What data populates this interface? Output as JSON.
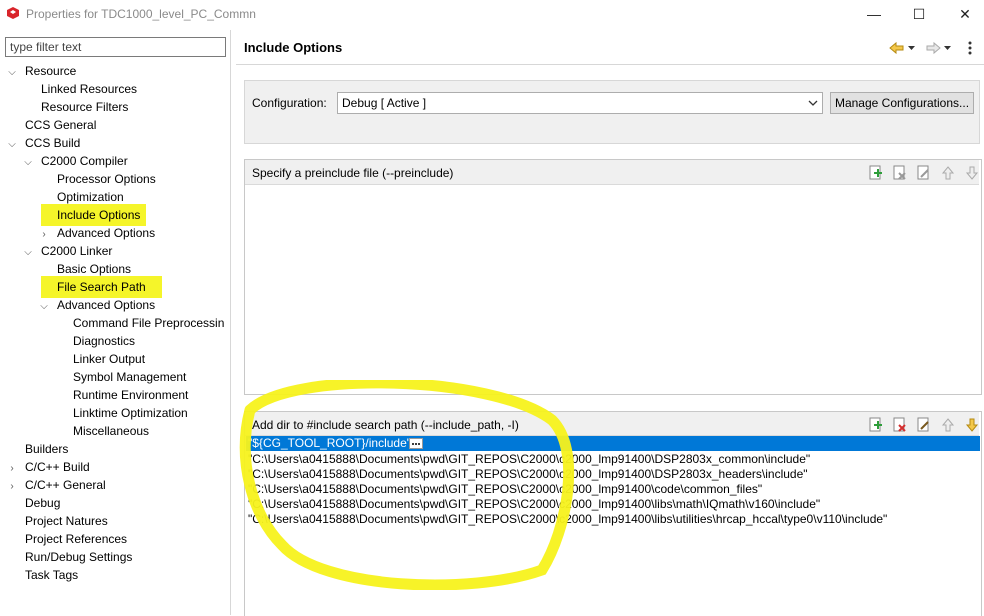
{
  "window": {
    "title": "Properties for TDC1000_level_PC_Commn",
    "minimize": "—",
    "maximize": "☐",
    "close": "✕"
  },
  "filter": {
    "placeholder": "type filter text"
  },
  "tree": [
    {
      "label": "Resource",
      "expanded": true
    },
    {
      "label": "Linked Resources"
    },
    {
      "label": "Resource Filters"
    },
    {
      "label": "CCS General"
    },
    {
      "label": "CCS Build",
      "expanded": true
    },
    {
      "label": "C2000 Compiler",
      "expanded": true
    },
    {
      "label": "Processor Options"
    },
    {
      "label": "Optimization"
    },
    {
      "label": "Include Options",
      "highlighted": true
    },
    {
      "label": "Advanced Options",
      "collapsed": true
    },
    {
      "label": "C2000 Linker",
      "expanded": true
    },
    {
      "label": "Basic Options"
    },
    {
      "label": "File Search Path",
      "highlighted": true
    },
    {
      "label": "Advanced Options",
      "expanded": true
    },
    {
      "label": "Command File Preprocessin"
    },
    {
      "label": "Diagnostics"
    },
    {
      "label": "Linker Output"
    },
    {
      "label": "Symbol Management"
    },
    {
      "label": "Runtime Environment"
    },
    {
      "label": "Linktime Optimization"
    },
    {
      "label": "Miscellaneous"
    },
    {
      "label": "Builders"
    },
    {
      "label": "C/C++ Build",
      "collapsed": true
    },
    {
      "label": "C/C++ General",
      "collapsed": true
    },
    {
      "label": "Debug"
    },
    {
      "label": "Project Natures"
    },
    {
      "label": "Project References"
    },
    {
      "label": "Run/Debug Settings"
    },
    {
      "label": "Task Tags"
    }
  ],
  "page": {
    "title": "Include Options",
    "config_label": "Configuration:",
    "config_value": "Debug  [ Active ]",
    "manage_button": "Manage Configurations..."
  },
  "preinclude": {
    "header": "Specify a preinclude file (--preinclude)"
  },
  "include_path": {
    "header": "Add dir to #include search path (--include_path, -I)",
    "selected": "\"${CG_TOOL_ROOT}/include\"",
    "items": [
      "\"C:\\Users\\a0415888\\Documents\\pwd\\GIT_REPOS\\C2000\\c2000_lmp91400\\DSP2803x_common\\include\"",
      "\"C:\\Users\\a0415888\\Documents\\pwd\\GIT_REPOS\\C2000\\c2000_lmp91400\\DSP2803x_headers\\include\"",
      "\"C:\\Users\\a0415888\\Documents\\pwd\\GIT_REPOS\\C2000\\c2000_lmp91400\\code\\common_files\"",
      "\"C:\\Users\\a0415888\\Documents\\pwd\\GIT_REPOS\\C2000\\c2000_lmp91400\\libs\\math\\IQmath\\v160\\include\"",
      "\"C:\\Users\\a0415888\\Documents\\pwd\\GIT_REPOS\\C2000\\c2000_lmp91400\\libs\\utilities\\hrcap_hccal\\type0\\v110\\include\""
    ]
  },
  "colors": {
    "selection": "#0078d7",
    "highlight": "#f5f52a",
    "annotation": "#f7f21c"
  }
}
